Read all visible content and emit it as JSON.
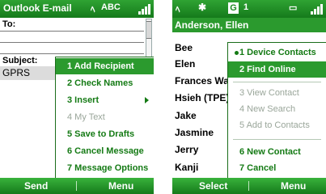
{
  "left": {
    "title": "Outlook E-mail",
    "status_text": "ABC",
    "to_label": "To:",
    "subject_label": "Subject:",
    "subject_value": "GPRS",
    "menu": [
      {
        "label": "1 Add Recipient",
        "state": "selected"
      },
      {
        "label": "2 Check Names",
        "state": "normal"
      },
      {
        "label": "3 Insert",
        "state": "normal",
        "submenu": true
      },
      {
        "label": "4 My Text",
        "state": "disabled"
      },
      {
        "label": "5 Save to Drafts",
        "state": "normal"
      },
      {
        "label": "6 Cancel Message",
        "state": "normal"
      },
      {
        "label": "7 Message Options",
        "state": "normal"
      }
    ],
    "softkeys": {
      "left": "Send",
      "right": "Menu"
    }
  },
  "right": {
    "status_number": "1",
    "status_badge": "G",
    "header": "Anderson, Ellen",
    "contacts": [
      "Bee",
      "Elen",
      "Frances Wa",
      "Hsieh (TPE)",
      "Jake",
      "Jasmine",
      "Jerry",
      "Kanji"
    ],
    "menu": [
      {
        "label": "1 Device Contacts",
        "state": "checked"
      },
      {
        "label": "2 Find Online",
        "state": "selected"
      },
      {
        "label": "3 View Contact",
        "state": "disabled"
      },
      {
        "label": "4 New Search",
        "state": "disabled"
      },
      {
        "label": "5 Add to Contacts",
        "state": "disabled"
      },
      {
        "label": "6 New Contact",
        "state": "normal"
      },
      {
        "label": "7 Cancel",
        "state": "normal"
      }
    ],
    "softkeys": {
      "left": "Select",
      "right": "Menu"
    }
  },
  "colors": {
    "accent": "#2b9a2e",
    "menu_text": "#147a14",
    "disabled": "#9aa69a"
  }
}
